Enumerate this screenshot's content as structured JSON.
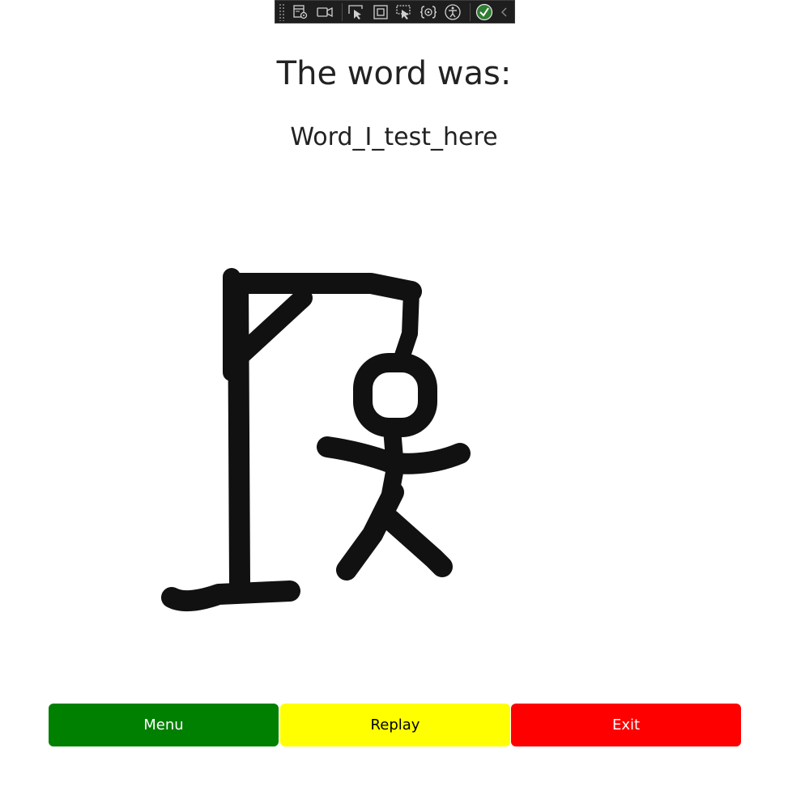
{
  "toolbar": {
    "icons": [
      "live-visual-tree-icon",
      "record-icon",
      "select-element-icon",
      "display-layout-adorners-icon",
      "track-focused-element-icon",
      "binding-failures-icon",
      "accessibility-checker-icon",
      "hot-reload-ok-icon",
      "collapse-chevron-icon"
    ]
  },
  "game_over": {
    "title": "The word was:",
    "word": "Word_I_test_here"
  },
  "buttons": {
    "menu": "Menu",
    "replay": "Replay",
    "exit": "Exit"
  },
  "colors": {
    "menu": "#008000",
    "replay": "#ffff00",
    "exit": "#ff0000"
  }
}
